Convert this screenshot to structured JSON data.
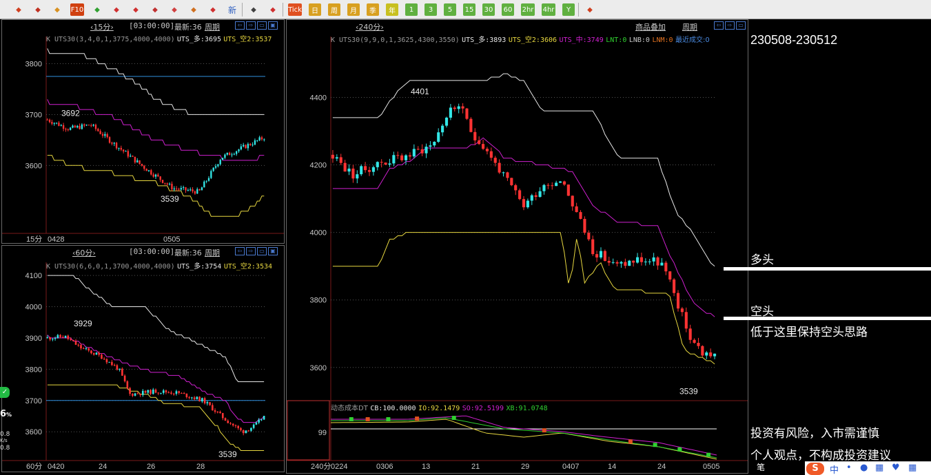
{
  "toolbar": {
    "buttons": [
      {
        "name": "back-icon",
        "label": "",
        "color": "#d04020"
      },
      {
        "name": "home-icon",
        "label": "",
        "color": "#c03020"
      },
      {
        "name": "database-icon",
        "label": "",
        "color": "#d89020"
      },
      {
        "name": "f10-icon",
        "label": "F10",
        "color": "#d04010"
      },
      {
        "name": "refresh-icon",
        "label": "",
        "color": "#30a030"
      },
      {
        "name": "zoom-in-icon",
        "label": "",
        "color": "#d03030"
      },
      {
        "name": "zoom-out-icon",
        "label": "",
        "color": "#d03030"
      },
      {
        "name": "window-icon",
        "label": "",
        "color": "#c03030"
      },
      {
        "name": "pencil-icon",
        "label": "",
        "color": "#d04040"
      },
      {
        "name": "tools-icon",
        "label": "",
        "color": "#d07020"
      },
      {
        "name": "filter-icon",
        "label": "",
        "color": "#d03030"
      },
      {
        "name": "new-icon",
        "label": "新",
        "color": "#3060c0"
      },
      {
        "name": "table-icon",
        "label": "",
        "color": "#404040"
      },
      {
        "name": "trend-icon",
        "label": "",
        "color": "#d03030"
      },
      {
        "name": "tick-icon",
        "label": "Tick",
        "color": "#e05020"
      },
      {
        "name": "day-icon",
        "label": "日",
        "color": "#d8a020"
      },
      {
        "name": "week-icon",
        "label": "周",
        "color": "#d8a020"
      },
      {
        "name": "month-icon",
        "label": "月",
        "color": "#d8a020"
      },
      {
        "name": "season-icon",
        "label": "季",
        "color": "#d8a020"
      },
      {
        "name": "year-icon",
        "label": "年",
        "color": "#c8c020"
      },
      {
        "name": "period-1-icon",
        "label": "1",
        "color": "#60b040"
      },
      {
        "name": "period-3-icon",
        "label": "3",
        "color": "#60b040"
      },
      {
        "name": "period-5-icon",
        "label": "5",
        "color": "#60b040"
      },
      {
        "name": "period-15-icon",
        "label": "15",
        "color": "#60b040"
      },
      {
        "name": "period-30-icon",
        "label": "30",
        "color": "#60b040"
      },
      {
        "name": "period-60-icon",
        "label": "60",
        "color": "#60b040"
      },
      {
        "name": "period-2hr-icon",
        "label": "2hr",
        "color": "#60b040"
      },
      {
        "name": "period-4hr-icon",
        "label": "4hr",
        "color": "#60b040"
      },
      {
        "name": "period-y-icon",
        "label": "Y",
        "color": "#60b040"
      },
      {
        "name": "calc-icon",
        "label": "",
        "color": "#d04020"
      }
    ]
  },
  "panel15": {
    "tab": "‹15分›",
    "time": "[03:00:00]",
    "latest": "最新:36",
    "cycle": "周期",
    "indicator": "K  UTS30(3,4,0,1,3775,4000,4000)",
    "up_label": "UTS_多:3695",
    "down_label": "UTS_空2:3537",
    "y_ticks": [
      "3800",
      "3700",
      "3600"
    ],
    "hi_label": "3692",
    "lo_label": "3539",
    "period": "15分",
    "dates": [
      "0428",
      "0505"
    ]
  },
  "panel60": {
    "tab": "‹60分›",
    "time": "[03:00:00]",
    "latest": "最新:36",
    "cycle": "周期",
    "indicator": "K  UTS30(6,6,0,1,3700,4000,4000)",
    "up_label": "UTS_多:3754",
    "down_label": "UTS_空2:3534",
    "y_ticks": [
      "4100",
      "4000",
      "3900",
      "3800",
      "3700",
      "3600"
    ],
    "hi_label": "3929",
    "lo_label": "3539",
    "period": "60分",
    "dates": [
      "0420",
      "24",
      "26",
      "28"
    ]
  },
  "panel240": {
    "tab": "‹240分›",
    "overlay": "商品叠加",
    "cycle": "周期",
    "indicator": "K  UTS30(9,9,0,1,3625,4300,3550)",
    "up_label": "UTS_多:3893",
    "down_label": "UTS_空2:3606",
    "mid_label": "UTS_中:3749",
    "lnt": "LNT:0",
    "lnb": "LNB:0",
    "lnm": "LNM:0",
    "last_trade": "最近成交:0",
    "y_ticks": [
      "4400",
      "4200",
      "4000",
      "3800",
      "3600"
    ],
    "hi_label": "4401",
    "lo_label": "3539",
    "sub_title": "动态成本DT",
    "cb": "CB:100.0000",
    "io": "IO:92.1479",
    "so": "SO:92.5199",
    "xb": "XB:91.0748",
    "sub_tick": "99",
    "period": "240分",
    "dates": [
      "0224",
      "0306",
      "13",
      "21",
      "29",
      "0407",
      "14",
      "24",
      "0505"
    ]
  },
  "sidebar": {
    "range": "230508-230512",
    "long": "多头",
    "short": "空头",
    "note": "低于这里保持空头思路",
    "risk": "投资有风险，入市需谨慎",
    "disclaimer": "个人观点，不构成投资建议",
    "pen": "笔"
  },
  "ime": {
    "brand": "S",
    "mode": "中"
  },
  "widget": {
    "percent": "6",
    "percent_sign": "%",
    "rate1": "0.8",
    "rate_unit": "K/s",
    "rate2": "0.8"
  },
  "colors": {
    "up": "#ff3333",
    "down": "#33e6e6",
    "long_line": "#e8e8e8",
    "mid_line": "#d020d0",
    "short_line": "#e8d840",
    "ref_line": "#2f8fe0",
    "sidebar_line": "#ffffff"
  }
}
